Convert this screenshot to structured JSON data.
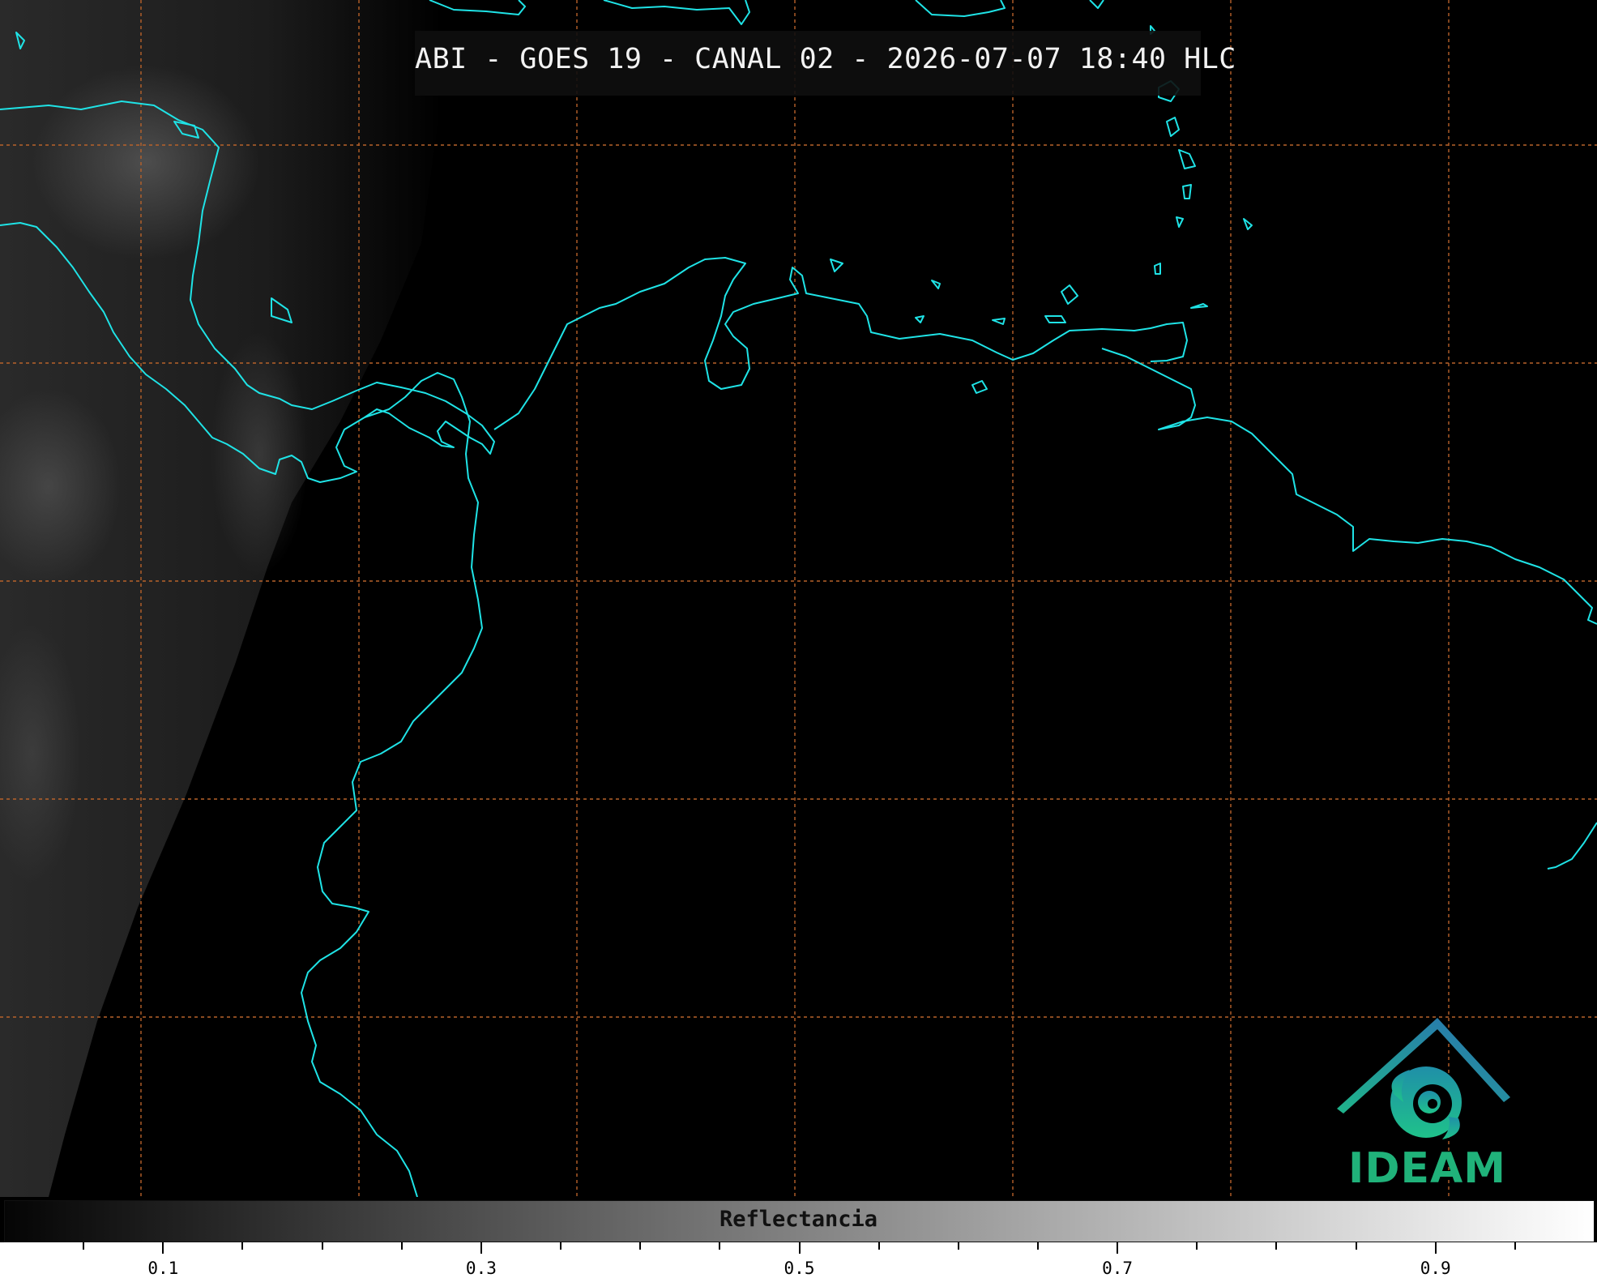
{
  "title": "ABI - GOES 19 - CANAL 02 - 2026-07-07 18:40 HLC",
  "colorbar": {
    "label": "Reflectancia",
    "tick_labels": [
      "0.1",
      "0.3",
      "0.5",
      "0.7",
      "0.9"
    ],
    "range": [
      0.0,
      1.0
    ]
  },
  "logo": {
    "text": "IDEAM"
  },
  "colors": {
    "coastline": "#1fe3e6",
    "grid": "#b8622a",
    "logo_green": "#20b27a",
    "logo_blue": "#2a6fb3"
  }
}
